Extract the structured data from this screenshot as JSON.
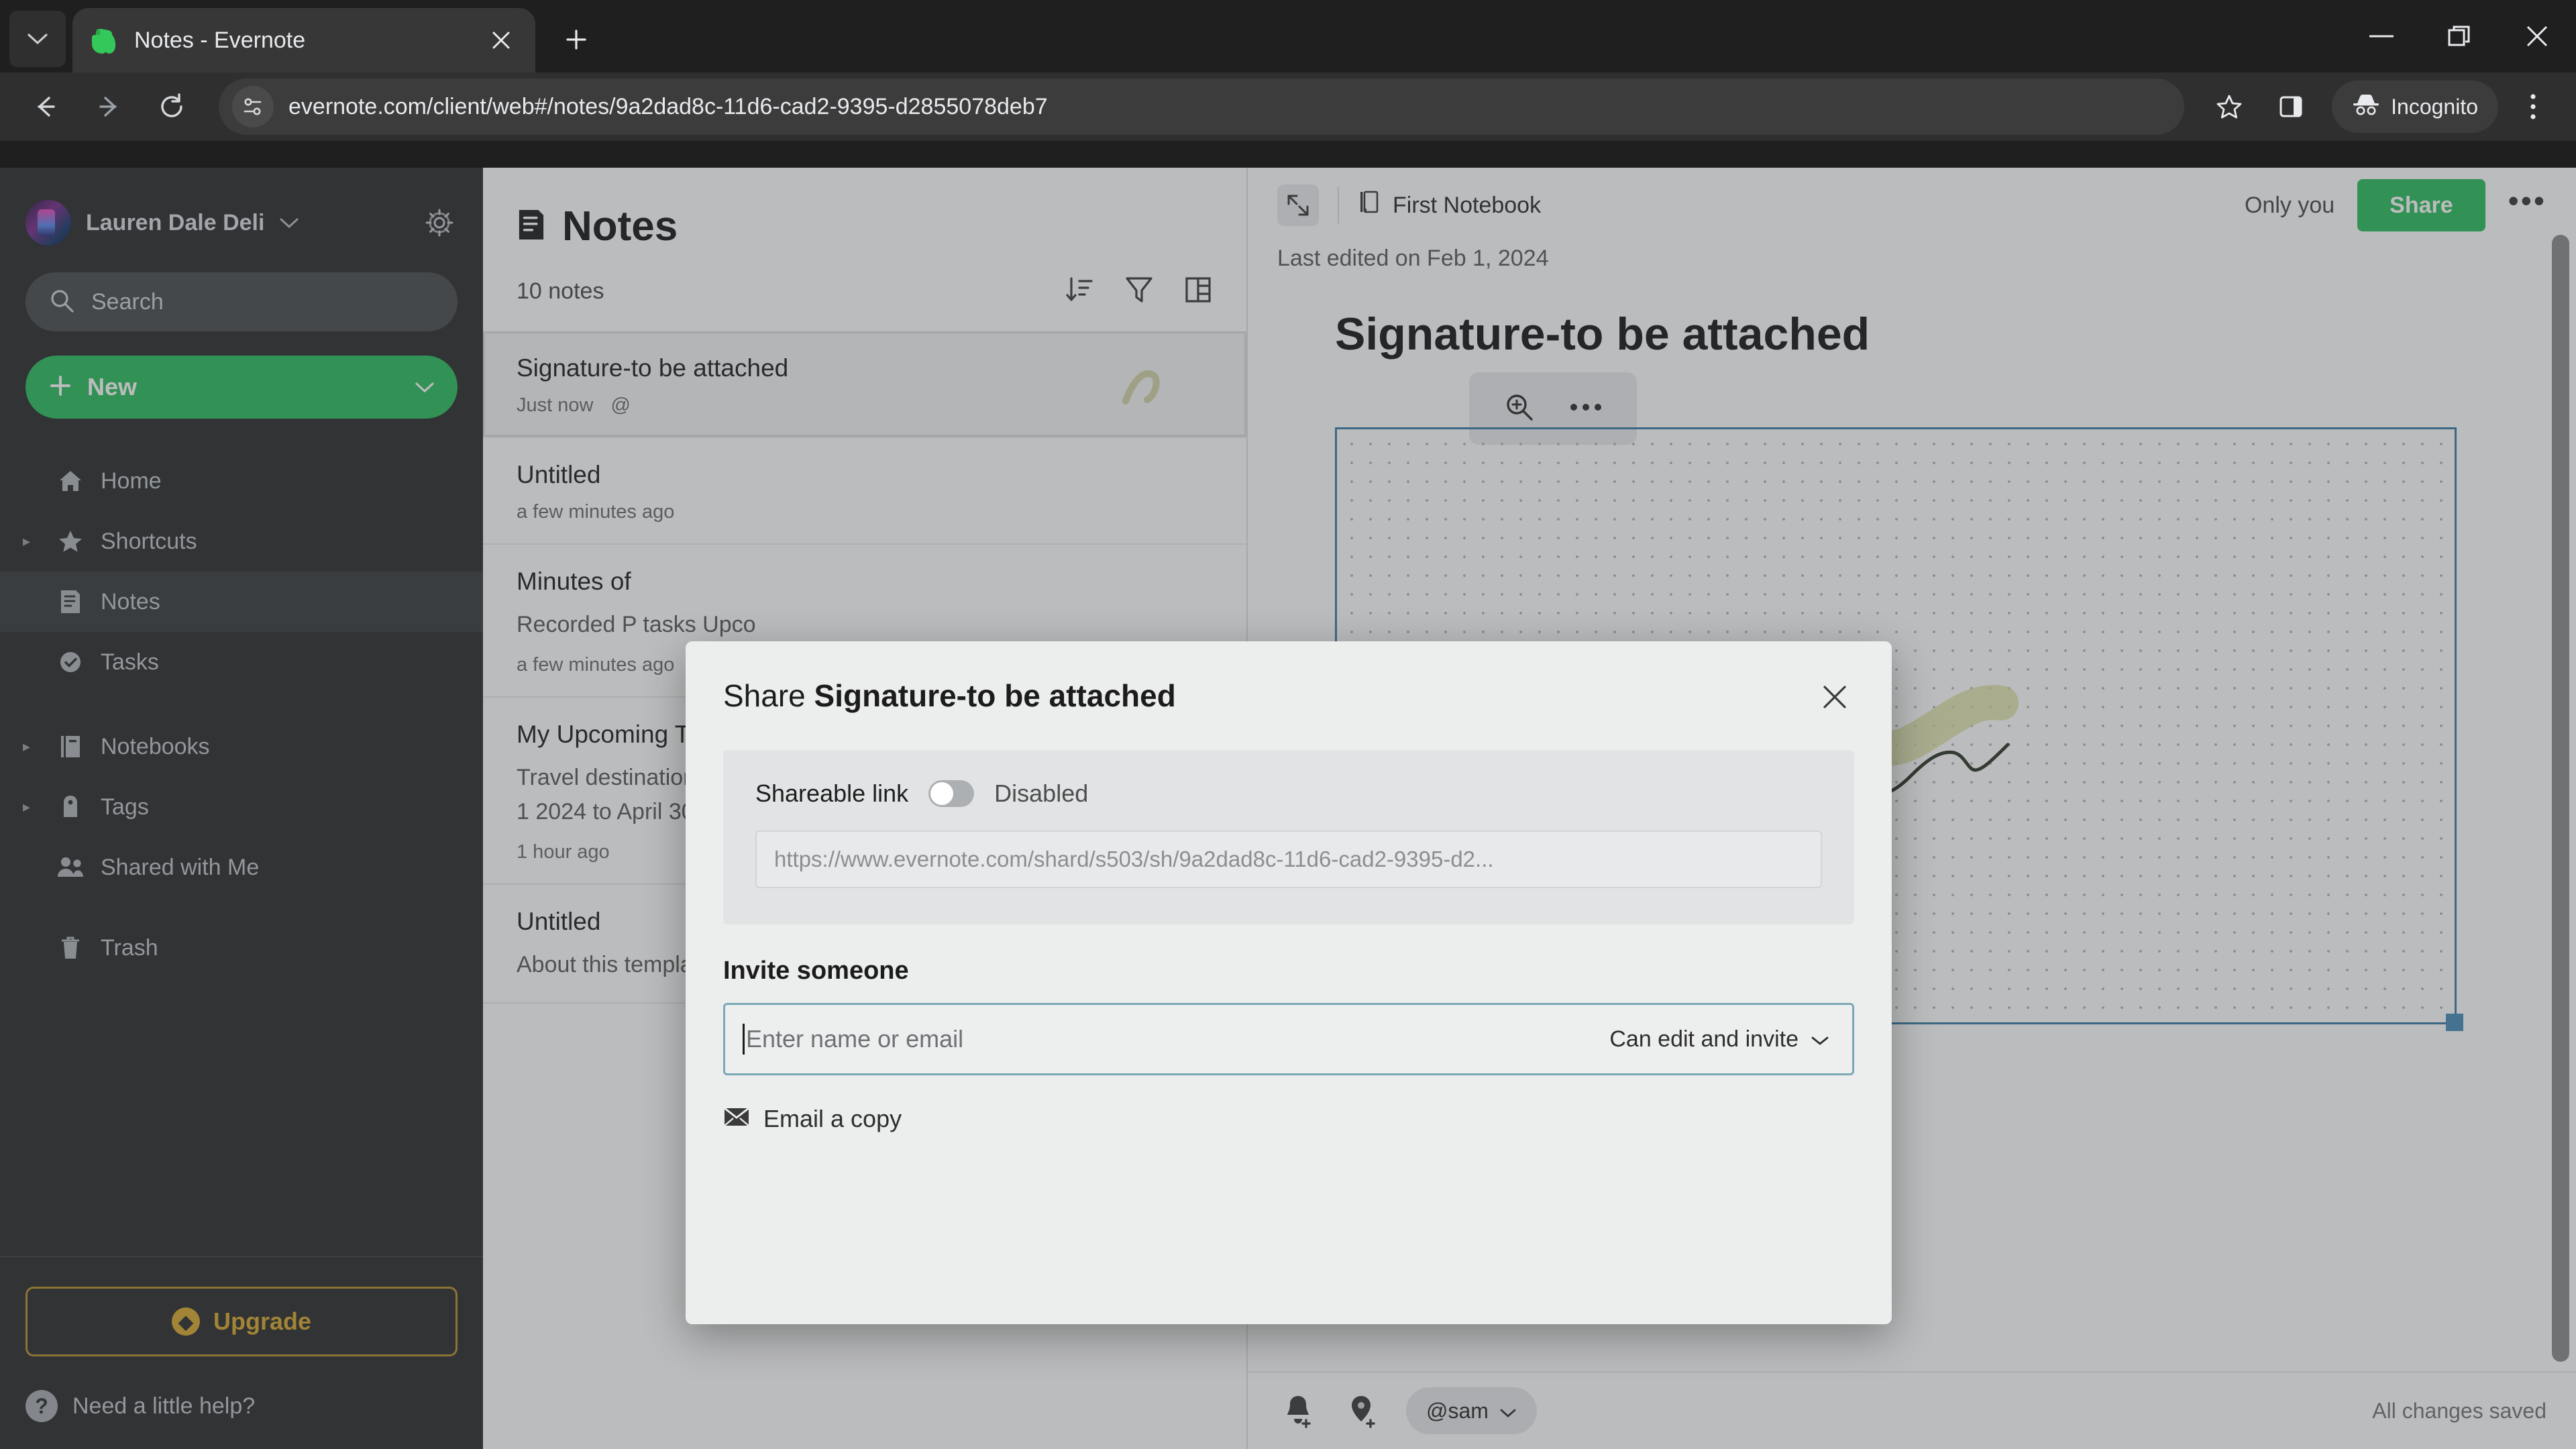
{
  "browser": {
    "tab": {
      "title": "Notes - Evernote",
      "favicon": "evernote-elephant-icon"
    },
    "tab_list_icon": "chevron-down-icon",
    "new_tab_icon": "plus-icon",
    "close_tab_icon": "close-icon",
    "window_controls": {
      "minimize": "minimize-icon",
      "maximize": "restore-icon",
      "close": "close-icon"
    },
    "nav": {
      "back": "back-arrow-icon",
      "forward": "forward-arrow-icon",
      "reload": "reload-icon"
    },
    "omnibox": {
      "site_info_icon": "page-settings-icon",
      "url": "evernote.com/client/web#/notes/9a2dad8c-11d6-cad2-9395-d2855078deb7"
    },
    "bookmark_icon": "star-icon",
    "side_panel_icon": "side-panel-icon",
    "profile": {
      "label": "Incognito",
      "icon": "incognito-hat-icon"
    },
    "menu_icon": "three-dots-vertical-icon"
  },
  "sidebar": {
    "account": {
      "name": "Lauren Dale Deli",
      "caret": "chevron-down-icon",
      "avatar": "user-avatar",
      "settings_icon": "gear-icon"
    },
    "search": {
      "placeholder": "Search",
      "icon": "search-icon"
    },
    "new_button": {
      "label": "New",
      "plus": "plus-icon",
      "caret": "chevron-down-icon"
    },
    "items": [
      {
        "label": "Home",
        "icon": "home-icon",
        "expandable": false,
        "active": false
      },
      {
        "label": "Shortcuts",
        "icon": "star-icon",
        "expandable": true,
        "active": false
      },
      {
        "label": "Notes",
        "icon": "notes-icon",
        "expandable": false,
        "active": true
      },
      {
        "label": "Tasks",
        "icon": "check-circle-icon",
        "expandable": false,
        "active": false
      },
      {
        "label": "Notebooks",
        "icon": "notebook-icon",
        "expandable": true,
        "active": false
      },
      {
        "label": "Tags",
        "icon": "tag-icon",
        "expandable": true,
        "active": false
      },
      {
        "label": "Shared with Me",
        "icon": "people-icon",
        "expandable": false,
        "active": false
      },
      {
        "label": "Trash",
        "icon": "trash-icon",
        "expandable": false,
        "active": false
      }
    ],
    "upgrade": {
      "label": "Upgrade",
      "icon": "diamond-icon"
    },
    "help": {
      "label": "Need a little help?",
      "icon": "question-mark-icon"
    }
  },
  "notes_list": {
    "header": {
      "title": "Notes",
      "icon": "notes-icon"
    },
    "count": "10 notes",
    "actions": {
      "sort": "sort-descending-icon",
      "filter": "filter-funnel-icon",
      "view": "list-view-icon"
    },
    "items": [
      {
        "title": "Signature-to be attached",
        "snippet": "",
        "meta": "Just now",
        "tag": "@",
        "selected": true
      },
      {
        "title": "Untitled",
        "snippet": "",
        "meta": "a few minutes ago",
        "selected": false
      },
      {
        "title": "Minutes of",
        "snippet": "Recorded P\ntasks Upco",
        "meta": "a few minutes ago",
        "selected": false
      },
      {
        "title": "My Upcoming Travel Schedule",
        "snippet": "Travel destinations: Alaska, America, Denver, etc. travel dates: May 1 2024 to April 30, 202...",
        "meta": "1 hour ago",
        "selected": false
      },
      {
        "title": "Untitled",
        "snippet": "About this template Use this template as a",
        "meta": "",
        "selected": false
      }
    ]
  },
  "editor": {
    "expand_icon": "expand-icon",
    "notebook": {
      "label": "First Notebook",
      "icon": "notebook-icon"
    },
    "share_status": "Only you",
    "share_button": "Share",
    "more_icon": "three-dots-icon",
    "last_edited": "Last edited on Feb 1, 2024",
    "note_title": "Signature-to be attached",
    "image_tools": {
      "zoom": "zoom-in-icon",
      "more": "three-dots-icon"
    },
    "bottom": {
      "reminder_icon": "bell-plus-icon",
      "task_icon": "pin-plus-icon",
      "mention": {
        "label": "@sam",
        "caret": "chevron-down-icon"
      },
      "saved_status": "All changes saved"
    }
  },
  "modal": {
    "title_prefix": "Share ",
    "title_note": "Signature-to be attached",
    "close_icon": "close-icon",
    "shareable_link": {
      "label": "Shareable link",
      "toggle_state": "Disabled",
      "toggle_on": false,
      "url": "https://www.evernote.com/shard/s503/sh/9a2dad8c-11d6-cad2-9395-d2..."
    },
    "invite": {
      "label": "Invite someone",
      "placeholder": "Enter name or email",
      "value": "",
      "permission": "Can edit and invite",
      "permission_caret": "chevron-down-icon"
    },
    "email_copy": {
      "label": "Email a copy",
      "icon": "envelope-icon"
    }
  },
  "colors": {
    "evernote_green": "#2dbe60",
    "upgrade_gold": "#d8a92f",
    "sidebar_bg": "#2b2d2f",
    "modal_bg": "#eceded",
    "focus_border": "#7aa9b5",
    "signature_box_border": "#3d7fa6"
  }
}
